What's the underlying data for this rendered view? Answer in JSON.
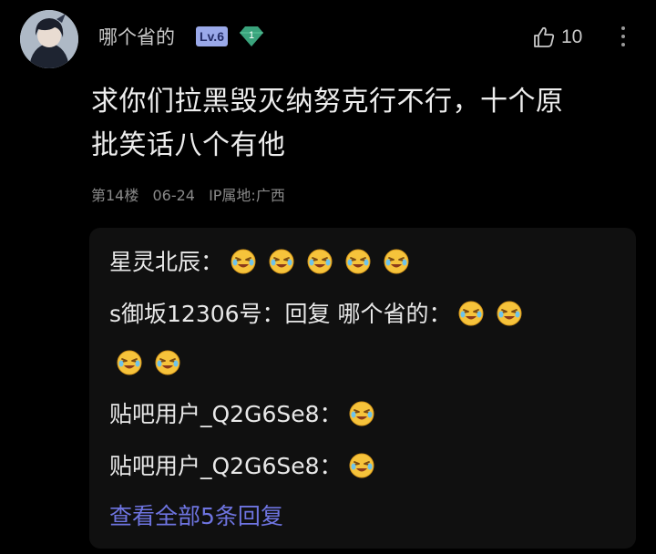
{
  "post": {
    "username": "哪个省的",
    "level": "Lv.6",
    "gem_level": "1",
    "like_count": "10",
    "content_lines": [
      "求你们拉黑毁灭纳努克行不行，十个原",
      "批笑话八个有他"
    ],
    "floor": "第14楼",
    "date": "06-24",
    "ip_location": "IP属地:广西"
  },
  "replies": [
    {
      "author": "星灵北辰：",
      "emoji_count": 5
    },
    {
      "author": "s御坂12306号：回复 哪个省的：",
      "emoji_count": 4
    },
    {
      "author": "贴吧用户_Q2G6Se8：",
      "emoji_count": 1
    },
    {
      "author": "贴吧用户_Q2G6Se8：",
      "emoji_count": 1
    }
  ],
  "view_all_label": "查看全部5条回复",
  "icons": {
    "like": "thumbs-up-icon",
    "more": "more-vertical-icon",
    "gem": "green-gem-icon",
    "emoji": "laughing-tears-emoji"
  },
  "colors": {
    "background": "#000000",
    "reply_box": "#101010",
    "link": "#6e74e0",
    "level_badge": "#9aa9e9",
    "gem": "#3aa37c"
  }
}
